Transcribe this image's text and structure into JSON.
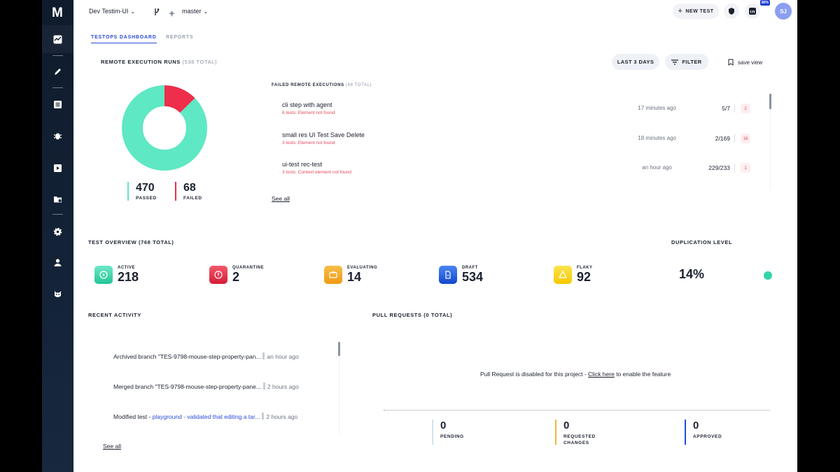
{
  "sidebar": {
    "logo": "M",
    "icons": [
      "activity-icon",
      "pencil-icon",
      "list-icon",
      "bug-icon",
      "play-icon",
      "folder-settings-icon",
      "gear-icon",
      "user-icon",
      "mask-icon"
    ]
  },
  "topbar": {
    "project": "Dev Testim-UI",
    "branch": "master",
    "new_test": "NEW TEST",
    "badge": "80%",
    "avatar": "SJ"
  },
  "tabs": [
    {
      "label": "TESTOPS DASHBOARD",
      "active": true
    },
    {
      "label": "REPORTS",
      "active": false
    }
  ],
  "remote_runs": {
    "title": "REMOTE EXECUTION RUNS",
    "total": "(538 TOTAL)",
    "last_days": "LAST 3 DAYS",
    "filter": "FILTER",
    "save_view": "save view",
    "passed": {
      "value": "470",
      "label": "PASSED",
      "count": 470
    },
    "failed": {
      "value": "68",
      "label": "FAILED",
      "count": 68
    }
  },
  "failed_executions": {
    "title": "FAILED REMOTE EXECUTIONS",
    "total": "(68 TOTAL)",
    "items": [
      {
        "name": "cli step with agent",
        "error": "6 tests: Element not found",
        "time": "17 minutes ago",
        "ratio": "5/7",
        "count": "2"
      },
      {
        "name": "small res UI Test Save Delete",
        "error": "3 tests: Element not found",
        "time": "18 minutes ago",
        "ratio": "2/169",
        "count": "16"
      },
      {
        "name": "ui-test rec-test",
        "error": "3 tests: Context element not found",
        "time": "an hour ago",
        "ratio": "229/233",
        "count": "1"
      }
    ],
    "see_all": "See all"
  },
  "overview": {
    "title": "TEST OVERVIEW",
    "total": "(768 TOTAL)",
    "duplication_title": "DUPLICATION LEVEL",
    "duplication_value": "14%",
    "items": [
      {
        "label": "ACTIVE",
        "value": "218",
        "color": "#2fd3a4"
      },
      {
        "label": "QUARANTINE",
        "value": "2",
        "color": "#e8334a"
      },
      {
        "label": "EVALUATING",
        "value": "14",
        "color": "#f5a623"
      },
      {
        "label": "DRAFT",
        "value": "534",
        "color": "#1e5fe0"
      },
      {
        "label": "FLAKY",
        "value": "92",
        "color": "#f7d21a"
      }
    ]
  },
  "activity": {
    "title": "RECENT ACTIVITY",
    "items": [
      {
        "text": "Archived branch \"TES-9798-mouse-step-property-pan...",
        "link": "",
        "ago": "an hour ago"
      },
      {
        "text": "Merged branch \"TES-9798-mouse-step-property-pane...",
        "link": "",
        "ago": "2 hours ago"
      },
      {
        "text": "Modified test - ",
        "link": "playground - validated that editing a tar...",
        "ago": "2 hours ago"
      }
    ],
    "see_all": "See all"
  },
  "pull_requests": {
    "title": "PULL REQUESTS",
    "total": "(0 TOTAL)",
    "message_before": "Pull Request is disabled for this project - ",
    "link": "Click here",
    "message_after": " to enable the feature",
    "stats": [
      {
        "value": "0",
        "label": "PENDING",
        "color": "#cfe3f0"
      },
      {
        "value": "0",
        "label": "REQUESTED CHANGES",
        "color": "#f2b63a"
      },
      {
        "value": "0",
        "label": "APPROVED",
        "color": "#1e4fd8"
      }
    ]
  },
  "colors": {
    "passed": "#5ee8c3",
    "failed": "#ee2e4a",
    "accent": "#2a4ad6"
  }
}
